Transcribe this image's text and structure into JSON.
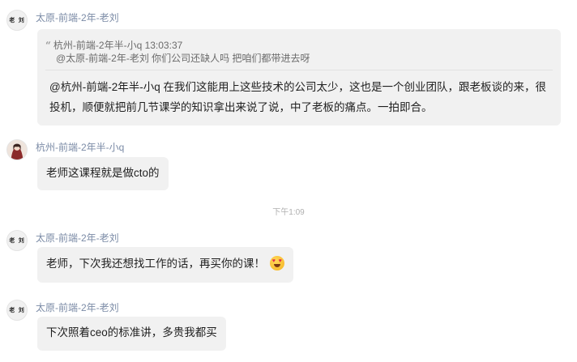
{
  "messages": [
    {
      "avatar_text": "老 刘",
      "sender": "太原-前端-2年-老刘",
      "quote": {
        "header": "杭州-前端-2年半-小q 13:03:37",
        "body": "@太原-前端-2年-老刘 你们公司还缺人吗 把咱们都带进去呀"
      },
      "text": "@杭州-前端-2年半-小q 在我们这能用上这些技术的公司太少，这也是一个创业团队，跟老板谈的来，很投机，顺便就把前几节课学的知识拿出来说了说，中了老板的痛点。一拍即合。"
    },
    {
      "sender": "杭州-前端-2年半-小q",
      "text": "老师这课程就是做cto的"
    },
    {
      "avatar_text": "老 刘",
      "sender": "太原-前端-2年-老刘",
      "text": "老师，下次我还想找工作的话，再买你的课！"
    },
    {
      "avatar_text": "老 刘",
      "sender": "太原-前端-2年-老刘",
      "text": "下次照着ceo的标准讲，多贵我都买"
    }
  ],
  "timestamp": "下午1:09",
  "icons": {
    "quote": "quote-icon",
    "emoji": "heart-eyes-emoji-icon"
  }
}
